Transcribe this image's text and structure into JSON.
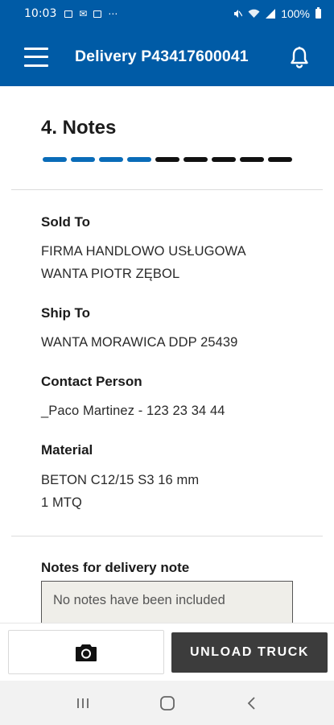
{
  "status_bar": {
    "time": "10:03",
    "battery": "100%",
    "icons": [
      "gallery-icon",
      "message-icon",
      "app-icon",
      "more-icon",
      "mute-icon",
      "wifi-icon",
      "signal-icon",
      "battery-icon"
    ]
  },
  "app_bar": {
    "title": "Delivery P43417600041",
    "menu_icon": "hamburger-menu-icon",
    "notification_icon": "bell-icon"
  },
  "section": {
    "title": "4. Notes",
    "steps_total": 9,
    "steps_completed": 4
  },
  "colors": {
    "brand": "#005ba6",
    "step_done": "#0a6cb8",
    "step_pending": "#111111",
    "primary_button": "#3c3c3c"
  },
  "fields": {
    "sold_to": {
      "label": "Sold To",
      "line1": "FIRMA HANDLOWO USŁUGOWA",
      "line2": "WANTA PIOTR ZĘBOL"
    },
    "ship_to": {
      "label": "Ship To",
      "value": "WANTA MORAWICA DDP 25439"
    },
    "contact_person": {
      "label": "Contact Person",
      "value": "_Paco Martinez - 123 23 34 44"
    },
    "material": {
      "label": "Material",
      "line1": "BETON C12/15 S3 16 mm",
      "line2": "1 MTQ"
    }
  },
  "notes": {
    "label": "Notes for delivery note",
    "placeholder": "No notes have been included"
  },
  "actions": {
    "camera_icon": "camera-icon",
    "unload_label": "UNLOAD TRUCK"
  },
  "nav": {
    "recents_icon": "recents-icon",
    "home_icon": "home-icon",
    "back_icon": "back-icon"
  }
}
